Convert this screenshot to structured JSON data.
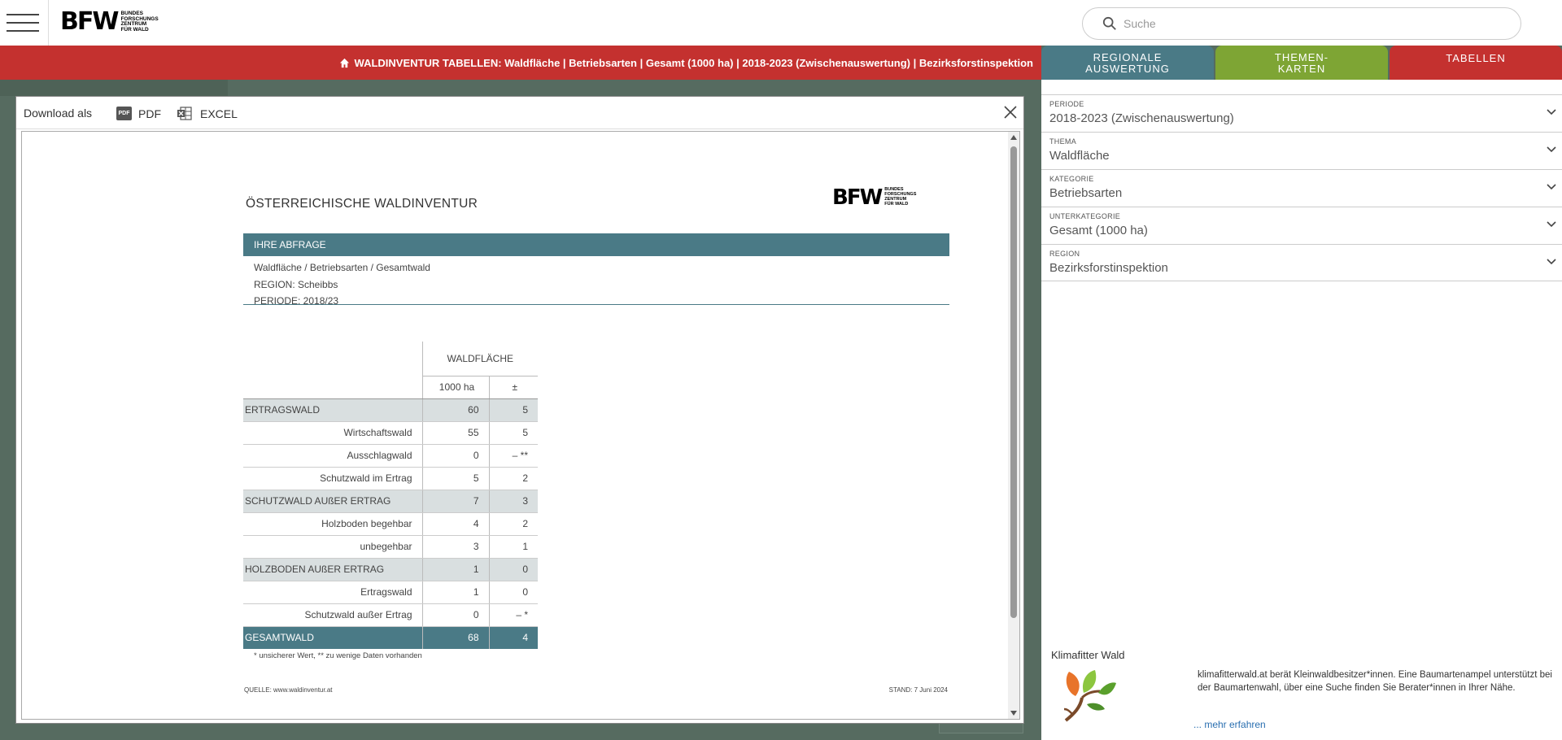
{
  "header": {
    "logo_mark": "BFW",
    "logo_sub": [
      "BUNDES",
      "FORSCHUNGS",
      "ZENTRUM",
      "FÜR WALD"
    ],
    "search_placeholder": "Suche"
  },
  "breadcrumb": "WALDINVENTUR TABELLEN: Waldfläche | Betriebsarten | Gesamt (1000 ha) | 2018-2023 (Zwischenauswertung) | Bezirksforstinspektion",
  "tabs": [
    {
      "label_line1": "REGIONALE",
      "label_line2": "AUSWERTUNG",
      "color": "#4a7a86"
    },
    {
      "label_line1": "THEMEN-",
      "label_line2": "KARTEN",
      "color": "#7ea534"
    },
    {
      "label_line1": "TABELLEN",
      "label_line2": "",
      "color": "#c4312f"
    }
  ],
  "filters": [
    {
      "label": "PERIODE",
      "value": "2018-2023 (Zwischenauswertung)"
    },
    {
      "label": "THEMA",
      "value": "Waldfläche"
    },
    {
      "label": "KATEGORIE",
      "value": "Betriebsarten"
    },
    {
      "label": "UNTERKATEGORIE",
      "value": "Gesamt (1000 ha)"
    },
    {
      "label": "REGION",
      "value": "Bezirksforstinspektion"
    }
  ],
  "klima": {
    "title": "Klimafitter Wald",
    "text": "klimafitterwald.at berät Kleinwaldbesitzer*innen. Eine Baumartenampel unterstützt bei der Baumartenwahl, über eine Suche finden Sie Berater*innen in Ihrer Nähe.",
    "link": "... mehr erfahren"
  },
  "modal": {
    "download_label": "Download als",
    "pdf_label": "PDF",
    "excel_label": "EXCEL",
    "pdf_icon_text": "PDF"
  },
  "doc": {
    "title": "ÖSTERREICHISCHE WALDINVENTUR",
    "query_head": "IHRE ABFRAGE",
    "query_lines": [
      "Waldfläche / Betriebsarten / Gesamtwald",
      "REGION: Scheibbs",
      "PERIODE: 2018/23"
    ],
    "table_header": "WALDFLÄCHE",
    "unit_label": "1000 ha",
    "pm_label": "±",
    "rows": [
      {
        "label": "ERTRAGSWALD",
        "value": "60",
        "pm": "5",
        "type": "group"
      },
      {
        "label": "Wirtschaftswald",
        "value": "55",
        "pm": "5",
        "type": "item"
      },
      {
        "label": "Ausschlagwald",
        "value": "0",
        "pm": "– **",
        "type": "item"
      },
      {
        "label": "Schutzwald im Ertrag",
        "value": "5",
        "pm": "2",
        "type": "item"
      },
      {
        "label": "SCHUTZWALD AUßER ERTRAG",
        "value": "7",
        "pm": "3",
        "type": "group"
      },
      {
        "label": "Holzboden begehbar",
        "value": "4",
        "pm": "2",
        "type": "item"
      },
      {
        "label": "unbegehbar",
        "value": "3",
        "pm": "1",
        "type": "item"
      },
      {
        "label": "HOLZBODEN AUßER ERTRAG",
        "value": "1",
        "pm": "0",
        "type": "group"
      },
      {
        "label": "Ertragswald",
        "value": "1",
        "pm": "0",
        "type": "item"
      },
      {
        "label": "Schutzwald außer Ertrag",
        "value": "0",
        "pm": "– *",
        "type": "item"
      },
      {
        "label": "GESAMTWALD",
        "value": "68",
        "pm": "4",
        "type": "total"
      }
    ],
    "footnote": "* unsicherer Wert, ** zu wenige Daten vorhanden",
    "source": "QUELLE: www.waldinventur.at",
    "stand": "STAND: 7 Juni 2024"
  }
}
